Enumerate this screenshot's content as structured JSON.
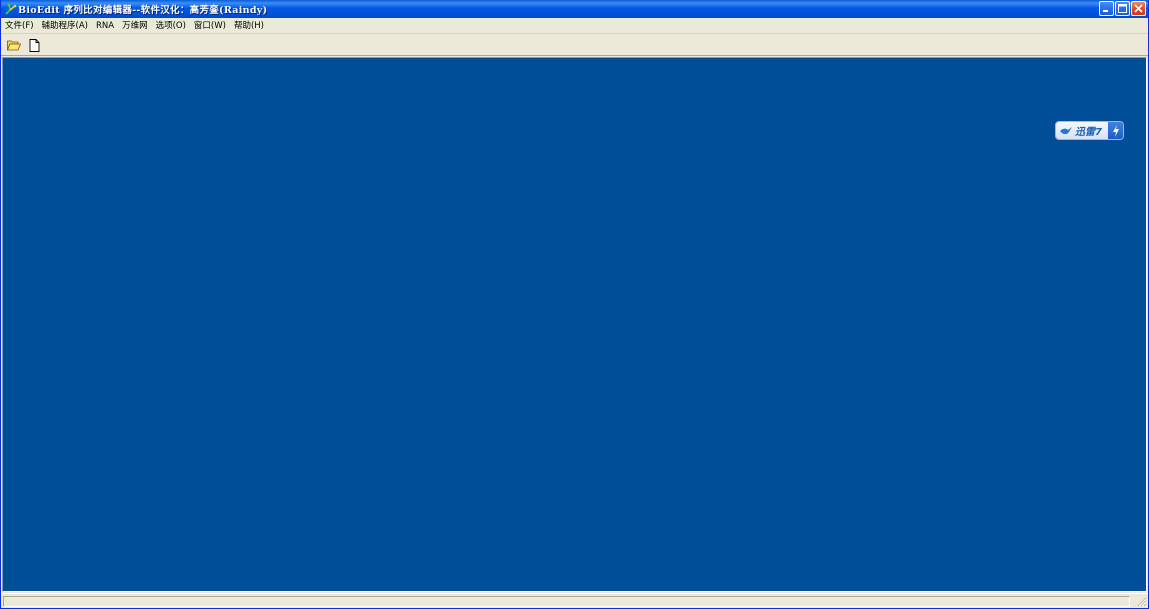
{
  "window": {
    "title": "BioEdit 序列比对编辑器--软件汉化：高芳銮(Raindy)",
    "icon": "bioedit-app-icon",
    "caption_buttons": [
      "minimize-icon",
      "maximize-icon",
      "close-icon"
    ]
  },
  "menubar": {
    "items": [
      {
        "label": "文件(F)"
      },
      {
        "label": "辅助程序(A)"
      },
      {
        "label": "RNA"
      },
      {
        "label": "万维网"
      },
      {
        "label": "选项(O)"
      },
      {
        "label": "窗口(W)"
      },
      {
        "label": "帮助(H)"
      }
    ]
  },
  "toolbar": {
    "buttons": [
      {
        "icon": "open-folder-icon",
        "title": "Open"
      },
      {
        "icon": "new-document-icon",
        "title": "New"
      }
    ]
  },
  "client_area": {
    "background": "#004e98"
  },
  "floating_badge": {
    "text": "迅雷7",
    "icon": "bird-icon",
    "action_icon": "lightning-icon"
  },
  "colors": {
    "titlebar": "#0058e6",
    "chrome": "#ece9d8",
    "client": "#004e98",
    "close_button": "#d9512c"
  }
}
